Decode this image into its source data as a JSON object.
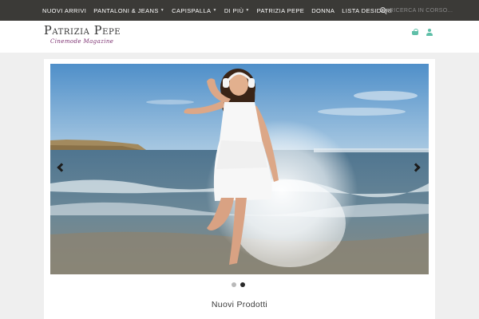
{
  "nav": {
    "items": [
      {
        "label": "NUOVI ARRIVI",
        "has_dropdown": false
      },
      {
        "label": "PANTALONI & JEANS",
        "has_dropdown": true
      },
      {
        "label": "CAPISPALLA",
        "has_dropdown": true
      },
      {
        "label": "DI PIÙ",
        "has_dropdown": true
      },
      {
        "label": "PATRIZIA PEPE",
        "has_dropdown": false
      },
      {
        "label": "DONNA",
        "has_dropdown": false
      },
      {
        "label": "LISTA DESIDERI",
        "has_dropdown": false
      }
    ],
    "dropdown_icon": "caret-down-icon"
  },
  "search": {
    "placeholder": "RICERCA IN CORSO...",
    "icon": "search-icon"
  },
  "header": {
    "logo_title": "Patrizia Pepe",
    "logo_subtitle": "Cinemode Magazine",
    "icons": [
      "shopping-basket-icon",
      "user-icon"
    ]
  },
  "slider": {
    "image_subject": "woman-splashing-in-sea",
    "prev_icon": "chevron-left-icon",
    "next_icon": "chevron-right-icon",
    "slide_count": 2,
    "active_slide": 2
  },
  "section": {
    "title": "Nuovi Prodotti"
  },
  "colors": {
    "topbar": "#3b3a37",
    "accent": "#5fbfa8",
    "logo_subtitle": "#7a2d6e",
    "page_bg": "#efefef"
  }
}
